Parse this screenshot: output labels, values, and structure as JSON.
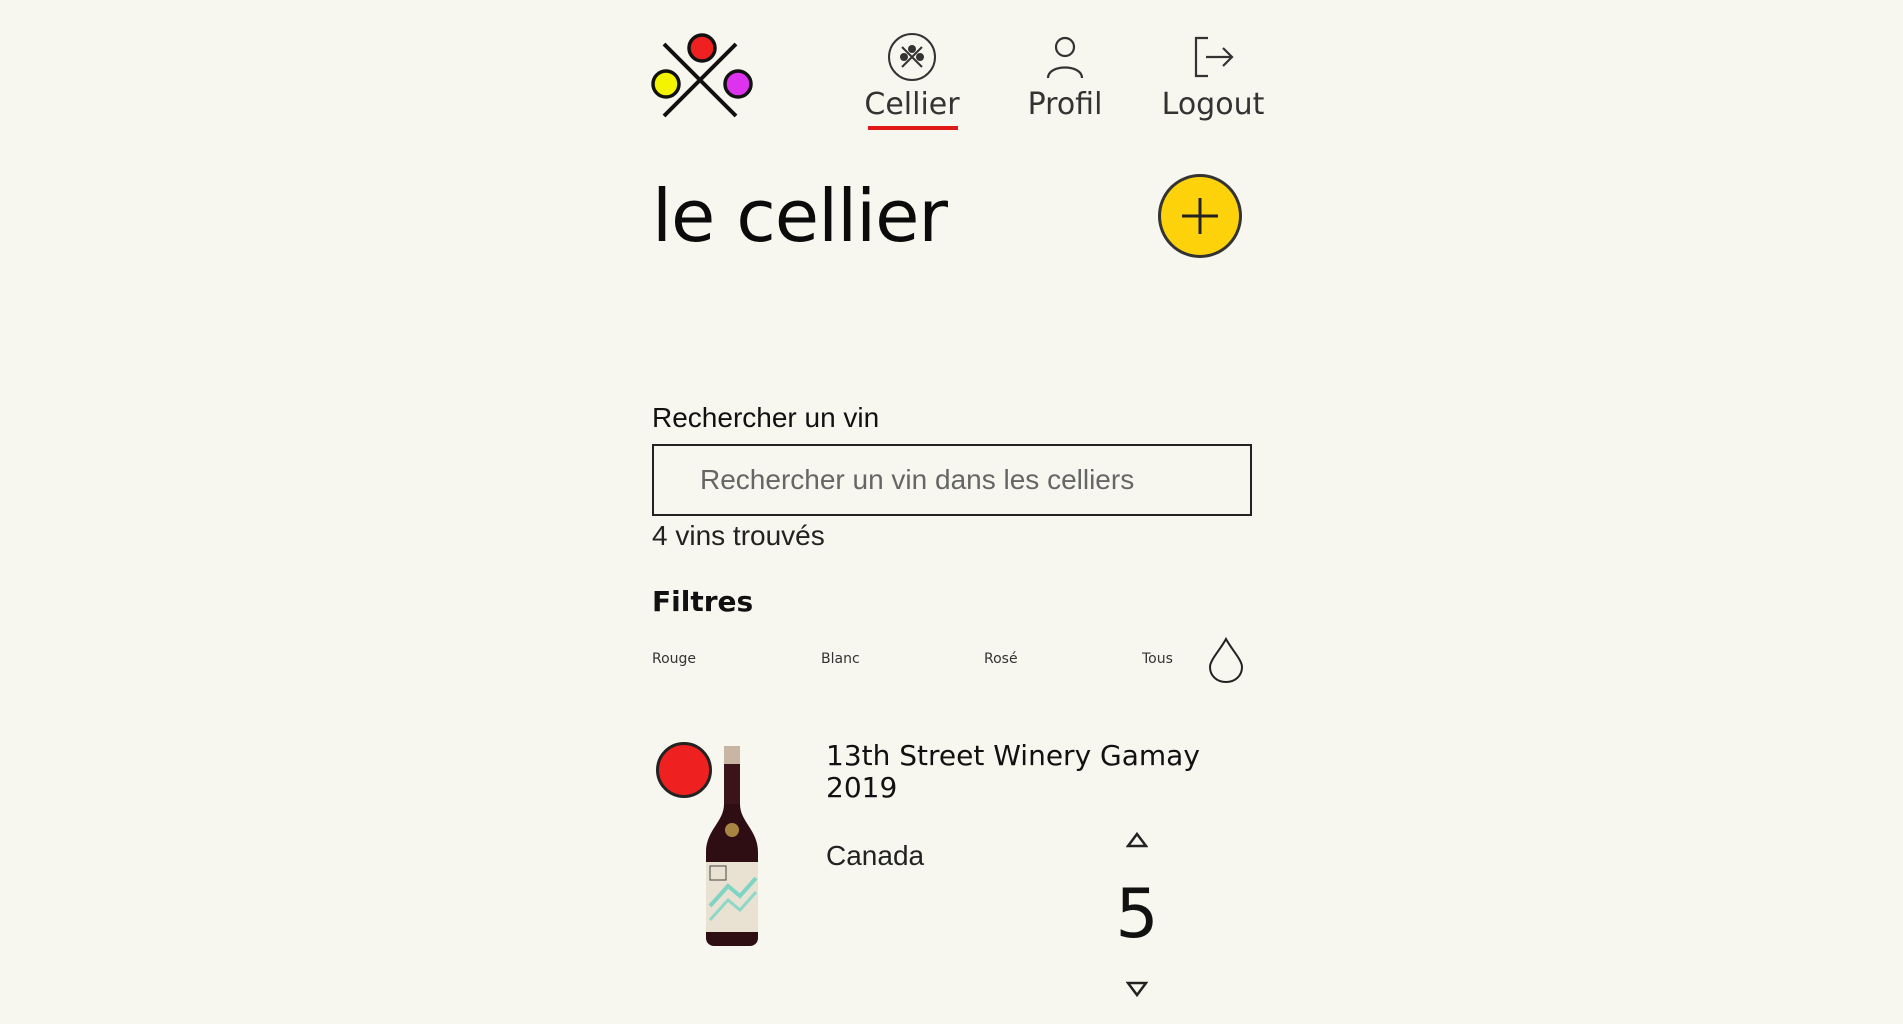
{
  "colors": {
    "background": "#f7f7ef",
    "accent_yellow": "#fdd20a",
    "accent_red": "#e01818",
    "wine_red": "#ee2020",
    "logo_yellow": "#f4f400",
    "logo_magenta": "#dd33ee"
  },
  "nav": {
    "items": [
      {
        "label": "Cellier",
        "icon": "cellar-icon",
        "active": true
      },
      {
        "label": "Profil",
        "icon": "user-icon",
        "active": false
      },
      {
        "label": "Logout",
        "icon": "logout-icon",
        "active": false
      }
    ]
  },
  "header": {
    "title": "le cellier",
    "add_icon": "plus-icon"
  },
  "search": {
    "label": "Rechercher un vin",
    "placeholder": "Rechercher un vin dans les celliers",
    "value": "",
    "results_text": "4 vins trouvés"
  },
  "filters": {
    "title": "Filtres",
    "options": [
      "Rouge",
      "Blanc",
      "Rosé",
      "Tous"
    ],
    "drop_icon": "drop-icon"
  },
  "wines": [
    {
      "name": "13th Street Winery Gamay 2019",
      "country": "Canada",
      "quantity": "5",
      "type_color": "red"
    }
  ]
}
